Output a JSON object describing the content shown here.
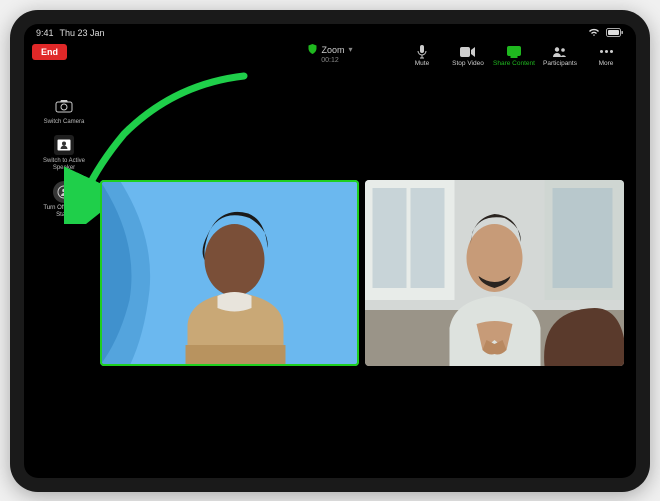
{
  "status": {
    "time": "9:41",
    "date": "Thu 23 Jan"
  },
  "zoom": {
    "end_label": "End",
    "title": "Zoom",
    "timer": "00:12",
    "controls": {
      "mute": "Mute",
      "stop_video": "Stop Video",
      "share_content": "Share Content",
      "participants": "Participants",
      "more": "More"
    }
  },
  "side": {
    "switch_camera": "Switch Camera",
    "switch_speaker": "Switch to Active Speaker",
    "center_stage": "Turn Off Center Stage"
  },
  "annotation": {
    "arrow_color": "#1fcf4a"
  }
}
